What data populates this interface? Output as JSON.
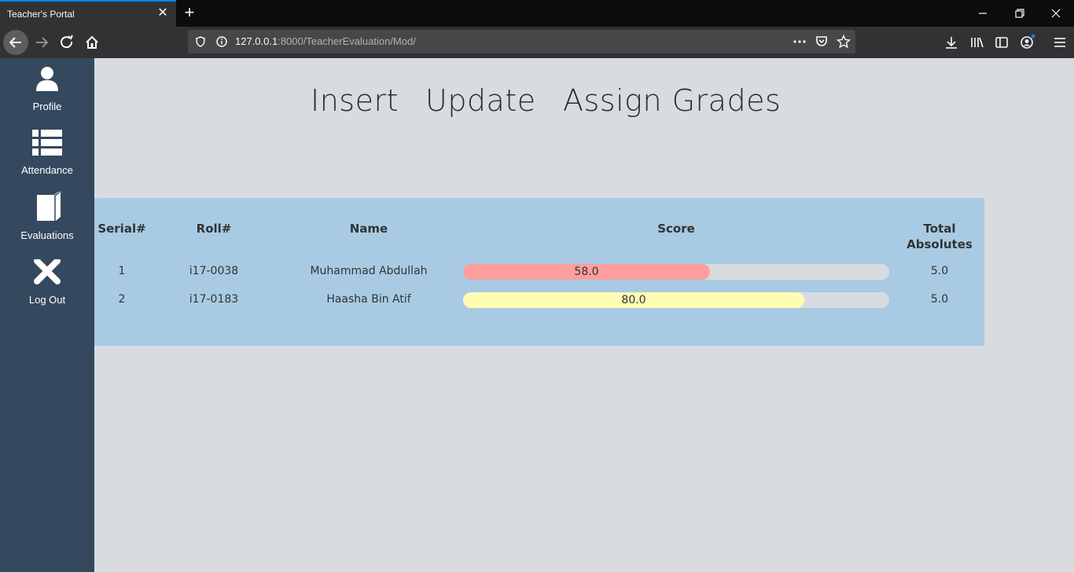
{
  "browser": {
    "tab_title": "Teacher's Portal",
    "url_host": "127.0.0.1",
    "url_rest": ":8000/TeacherEvaluation/Mod/"
  },
  "sidebar": {
    "items": [
      {
        "label": "Profile",
        "icon": "user-icon"
      },
      {
        "label": "Attendance",
        "icon": "list-icon"
      },
      {
        "label": "Evaluations",
        "icon": "book-icon"
      },
      {
        "label": "Log Out",
        "icon": "close-icon"
      }
    ]
  },
  "menu": {
    "insert": "Insert",
    "update": "Update",
    "assign": "Assign Grades"
  },
  "table": {
    "headers": {
      "serial": "Serial#",
      "roll": "Roll#",
      "name": "Name",
      "score": "Score",
      "total_line1": "Total",
      "total_line2": "Absolutes"
    },
    "rows": [
      {
        "serial": "1",
        "roll": "i17-0038",
        "name": "Muhammad Abdullah",
        "score": "58.0",
        "score_fraction": 0.58,
        "bar_color": "#ff9e9e",
        "total": "5.0"
      },
      {
        "serial": "2",
        "roll": "i17-0183",
        "name": "Haasha Bin Atif",
        "score": "80.0",
        "score_fraction": 0.8,
        "bar_color": "#fffcb4",
        "total": "5.0"
      }
    ]
  },
  "colors": {
    "sidebar_bg": "#34495e",
    "page_bg": "#d8dce1",
    "panel_bg": "#a8cbe3"
  }
}
